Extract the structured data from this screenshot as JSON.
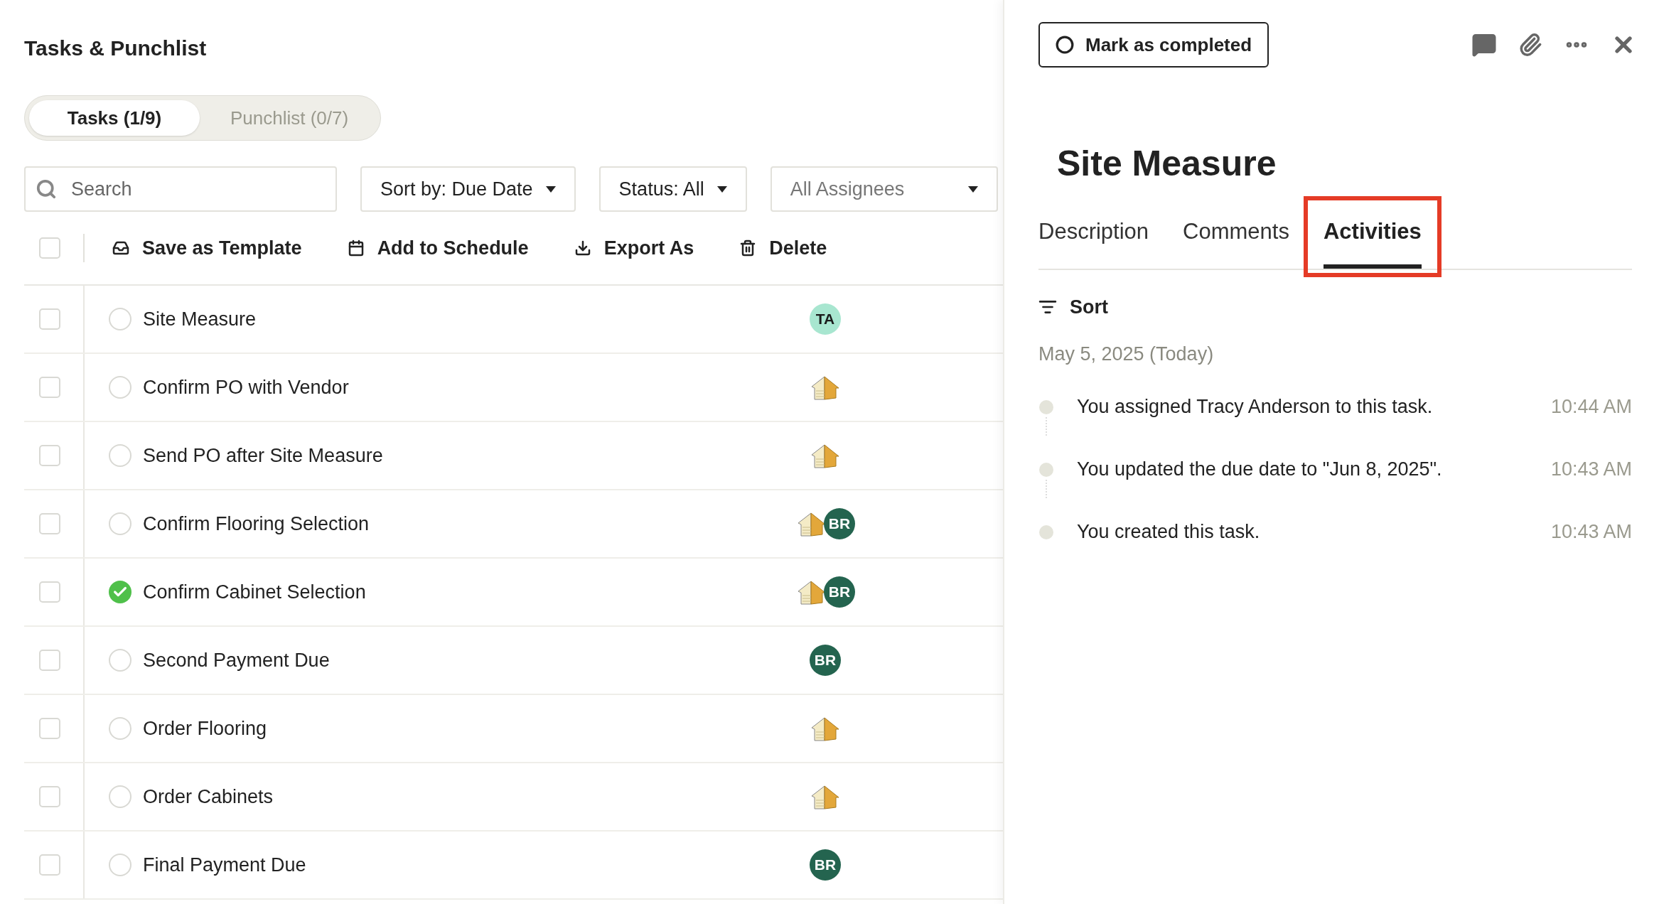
{
  "page": {
    "title": "Tasks & Punchlist"
  },
  "segments": [
    {
      "label": "Tasks (1/9)",
      "selected": true
    },
    {
      "label": "Punchlist (0/7)",
      "selected": false
    }
  ],
  "search": {
    "placeholder": "Search"
  },
  "filters": [
    {
      "label": "Sort by: Due Date",
      "placeholder": false
    },
    {
      "label": "Status: All",
      "placeholder": false
    },
    {
      "label": "All Assignees",
      "placeholder": true
    }
  ],
  "select_all": {
    "checked": false
  },
  "actions": [
    {
      "kind": "template",
      "label": "Save as Template"
    },
    {
      "kind": "schedule",
      "label": "Add to Schedule"
    },
    {
      "kind": "export",
      "label": "Export As"
    },
    {
      "kind": "delete",
      "label": "Delete"
    }
  ],
  "tasks": [
    {
      "name": "Site Measure",
      "checked": false,
      "completed": false,
      "assignees": [
        {
          "kind": "initials",
          "text": "TA",
          "color": "#a8e6d0"
        }
      ]
    },
    {
      "name": "Confirm PO with Vendor",
      "checked": false,
      "completed": false,
      "assignees": [
        {
          "kind": "company"
        }
      ]
    },
    {
      "name": "Send PO after Site Measure",
      "checked": false,
      "completed": false,
      "assignees": [
        {
          "kind": "company"
        }
      ]
    },
    {
      "name": "Confirm Flooring Selection",
      "checked": false,
      "completed": false,
      "assignees": [
        {
          "kind": "company"
        },
        {
          "kind": "initials",
          "text": "BR",
          "color": "#24644f"
        }
      ]
    },
    {
      "name": "Confirm Cabinet Selection",
      "checked": false,
      "completed": true,
      "assignees": [
        {
          "kind": "company"
        },
        {
          "kind": "initials",
          "text": "BR",
          "color": "#24644f"
        }
      ]
    },
    {
      "name": "Second Payment Due",
      "checked": false,
      "completed": false,
      "assignees": [
        {
          "kind": "initials",
          "text": "BR",
          "color": "#24644f"
        }
      ]
    },
    {
      "name": "Order Flooring",
      "checked": false,
      "completed": false,
      "assignees": [
        {
          "kind": "company"
        }
      ]
    },
    {
      "name": "Order Cabinets",
      "checked": false,
      "completed": false,
      "assignees": [
        {
          "kind": "company"
        }
      ]
    },
    {
      "name": "Final Payment Due",
      "checked": false,
      "completed": false,
      "assignees": [
        {
          "kind": "initials",
          "text": "BR",
          "color": "#24644f"
        }
      ]
    }
  ],
  "detail": {
    "mark_button": "Mark as completed",
    "title": "Site Measure",
    "tabs": [
      {
        "label": "Description",
        "selected": false,
        "highlighted": false
      },
      {
        "label": "Comments",
        "selected": false,
        "highlighted": false
      },
      {
        "label": "Activities",
        "selected": true,
        "highlighted": true
      }
    ],
    "sort_label": "Sort",
    "date": "May 5, 2025 (Today)",
    "activities": [
      {
        "text": "You assigned Tracy Anderson to this task.",
        "time": "10:44 AM"
      },
      {
        "text": "You updated the due date to \"Jun 8, 2025\".",
        "time": "10:43 AM"
      },
      {
        "text": "You created this task.",
        "time": "10:43 AM"
      }
    ]
  }
}
